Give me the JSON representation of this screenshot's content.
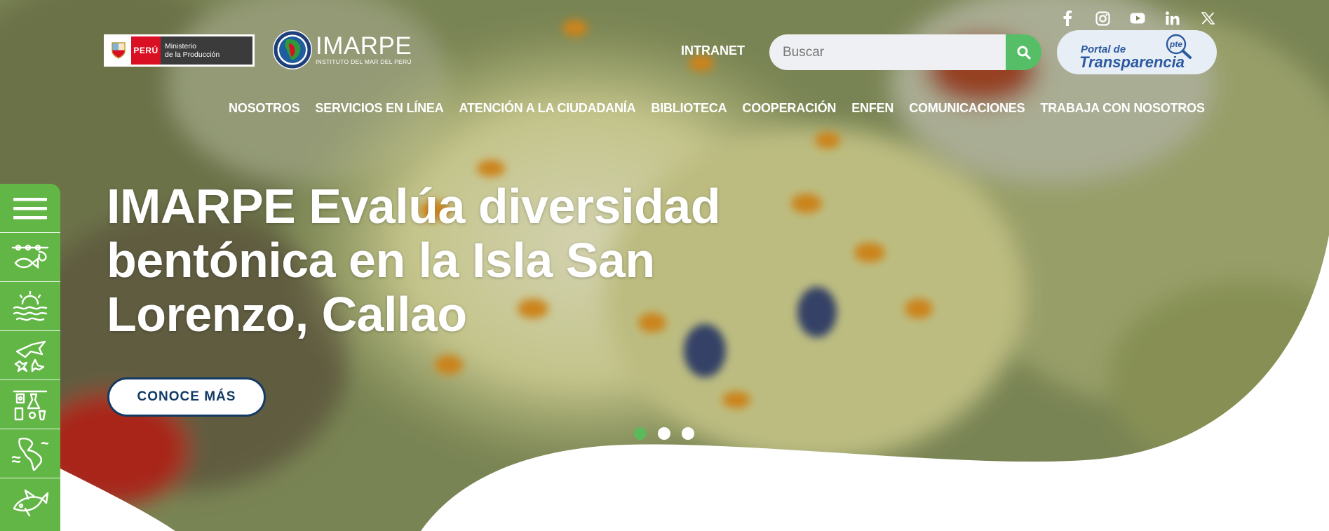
{
  "header": {
    "produce_logo": {
      "country": "PERÚ",
      "ministry_line1": "Ministerio",
      "ministry_line2": "de la Producción"
    },
    "imarpe_logo": {
      "name": "IMARPE",
      "subtitle": "INSTITUTO DEL MAR DEL PERÚ"
    },
    "intranet_label": "INTRANET",
    "search": {
      "placeholder": "Buscar",
      "icon": "search-icon"
    },
    "transparencia": {
      "line1": "Portal de",
      "line2": "Transparencia",
      "badge": "pte"
    },
    "social": [
      {
        "name": "facebook",
        "icon": "facebook-icon"
      },
      {
        "name": "instagram",
        "icon": "instagram-icon"
      },
      {
        "name": "youtube",
        "icon": "youtube-icon"
      },
      {
        "name": "linkedin",
        "icon": "linkedin-icon"
      },
      {
        "name": "x",
        "icon": "x-icon"
      }
    ]
  },
  "nav": {
    "items": [
      "NOSOTROS",
      "SERVICIOS EN LÍNEA",
      "ATENCIÓN A LA CIUDADANÍA",
      "BIBLIOTECA",
      "COOPERACIÓN",
      "ENFEN",
      "COMUNICACIONES",
      "TRABAJA CON NOSOTROS"
    ]
  },
  "sidebar": {
    "items": [
      {
        "icon": "hamburger-menu-icon"
      },
      {
        "icon": "fishing-hook-icon"
      },
      {
        "icon": "ocean-weather-icon"
      },
      {
        "icon": "marine-species-icon"
      },
      {
        "icon": "lab-equipment-icon"
      },
      {
        "icon": "americas-map-icon"
      },
      {
        "icon": "fish-icon"
      }
    ]
  },
  "slide": {
    "headline": "IMARPE Evalúa diversidad bentónica en la Isla San Lorenzo, Callao",
    "cta_label": "CONOCE MÁS",
    "dots_count": 3,
    "active_dot": 0
  },
  "colors": {
    "accent_green": "#62b646",
    "search_green": "#55be67",
    "navy": "#123a63",
    "transparencia_blue": "#2c5aa0"
  }
}
